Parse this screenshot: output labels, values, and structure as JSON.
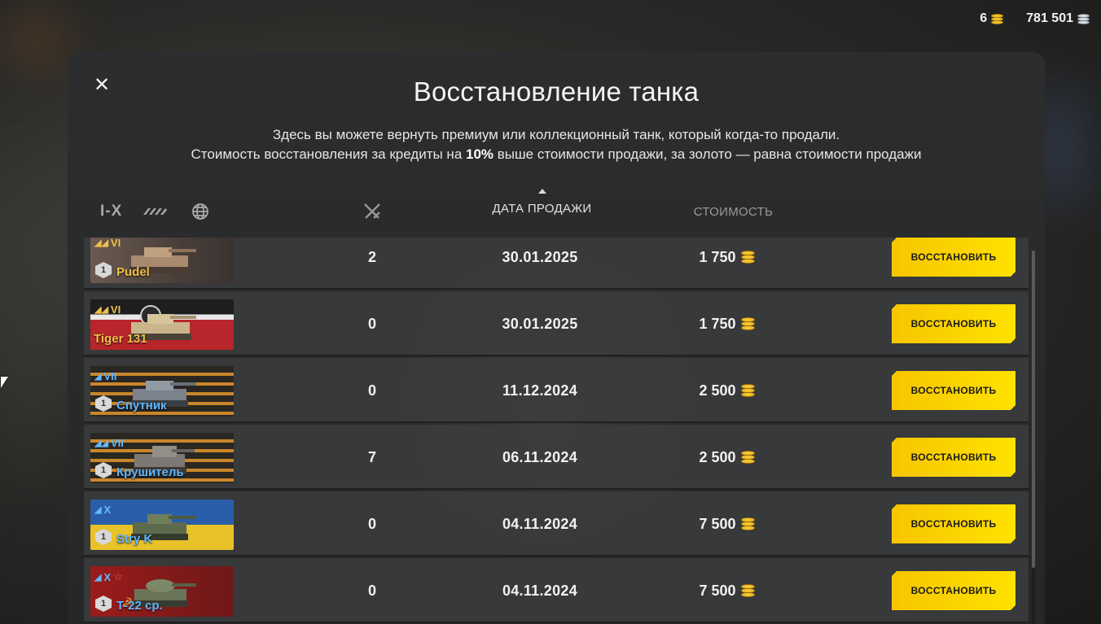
{
  "currency": {
    "gold": "6",
    "credits": "781 501",
    "gold_icon": "gold-coins-icon",
    "credits_icon": "silver-coins-icon"
  },
  "modal": {
    "close_icon": "close-icon",
    "title": "Восстановление танка",
    "desc_line1": "Здесь вы можете вернуть премиум или коллекционный танк, который когда-то продали.",
    "desc_line2_a": "Стоимость восстановления за кредиты на ",
    "desc_line2_bold": "10%",
    "desc_line2_b": " выше стоимости продажи, за золото — равна стоимости продажи"
  },
  "filters": {
    "tier_label": "I-X",
    "type_icon": "vehicle-type-filter-icon",
    "nation_icon": "globe-icon"
  },
  "columns": {
    "battles_icon": "crossed-swords-icon",
    "sale_date": "ДАТА ПРОДАЖИ",
    "cost": "СТОИМОСТЬ",
    "sort": "ascending"
  },
  "restore_label": "ВОССТАНОВИТЬ",
  "colors": {
    "accent_button": "#ffd200",
    "gold_name": "#f1c04a",
    "premium_name": "#62b8ff"
  },
  "rows": [
    {
      "tier": "VI",
      "name": "Pudel",
      "name_color": "gold",
      "badge": "1",
      "battles": "2",
      "date": "30.01.2025",
      "cost": "1 750"
    },
    {
      "tier": "VI",
      "name": "Tiger 131",
      "name_color": "gold",
      "badge": "",
      "battles": "0",
      "date": "30.01.2025",
      "cost": "1 750"
    },
    {
      "tier": "VII",
      "name": "Спутник",
      "name_color": "blue",
      "badge": "1",
      "battles": "0",
      "date": "11.12.2024",
      "cost": "2 500"
    },
    {
      "tier": "VII",
      "name": "Крушитель",
      "name_color": "blue",
      "badge": "1",
      "battles": "7",
      "date": "06.11.2024",
      "cost": "2 500"
    },
    {
      "tier": "X",
      "name": "Stry K",
      "name_color": "blue",
      "badge": "1",
      "battles": "0",
      "date": "04.11.2024",
      "cost": "7 500"
    },
    {
      "tier": "X",
      "name": "Т-22 ср.",
      "name_color": "blue",
      "badge": "1",
      "battles": "0",
      "date": "04.11.2024",
      "cost": "7 500"
    }
  ]
}
